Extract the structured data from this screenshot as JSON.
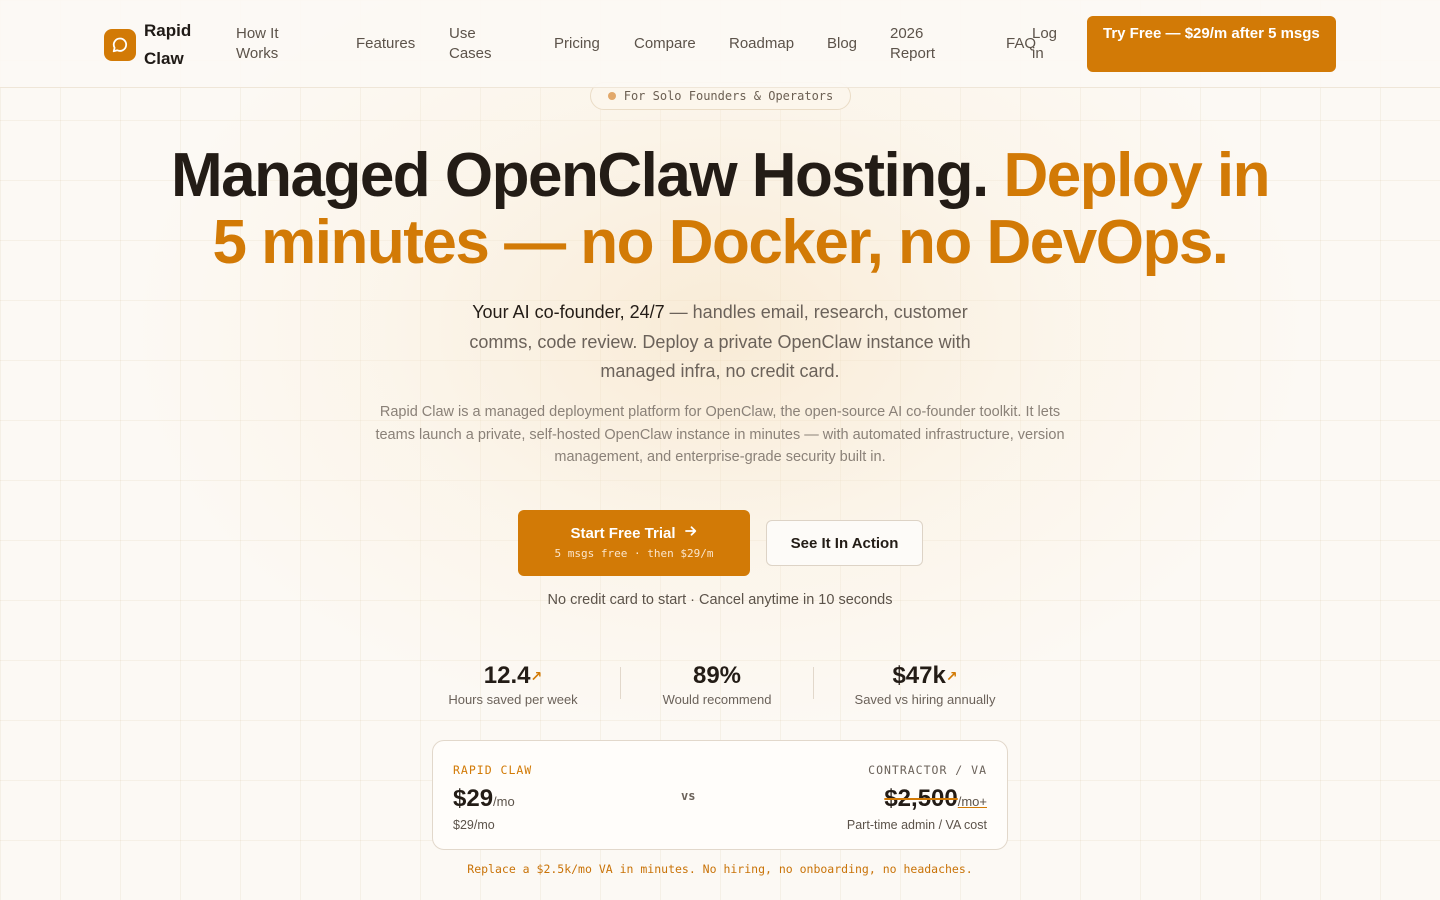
{
  "brand": {
    "name": "Rapid Claw",
    "accent": "#d27a06"
  },
  "nav": {
    "links": [
      "How It Works",
      "Features",
      "Use Cases",
      "Pricing",
      "Compare",
      "Roadmap",
      "Blog",
      "2026 Report",
      "FAQ"
    ],
    "login": "Log in",
    "cta": "Try Free — $29/m after 5 msgs"
  },
  "hero": {
    "badge": "For Solo Founders & Operators",
    "headline_dark": "Managed OpenClaw Hosting.",
    "headline_accent": "Deploy in 5 minutes — no Docker, no DevOps.",
    "subhead_strong": "Your AI co-founder, 24/7",
    "subhead_rest": " — handles email, research, customer comms, code review. Deploy a private OpenClaw instance with managed infra, no credit card.",
    "description": "Rapid Claw is a managed deployment platform for OpenClaw, the open-source AI co-founder toolkit. It lets teams launch a private, self-hosted OpenClaw instance in minutes — with automated infrastructure, version management, and enterprise-grade security built in.",
    "primary_cta": "Start Free Trial",
    "primary_cta_sub": "5 msgs free · then $29/m",
    "secondary_cta": "See It In Action",
    "fine_print": "No credit card to start · Cancel anytime in 10 seconds"
  },
  "stats": [
    {
      "value": "12.4",
      "arrow": "↗",
      "label": "Hours saved per week"
    },
    {
      "value": "89%",
      "arrow": "",
      "label": "Would recommend"
    },
    {
      "value": "$47k",
      "arrow": "↗",
      "label": "Saved vs hiring annually"
    }
  ],
  "compare": {
    "left_label": "RAPID CLAW",
    "left_price": "$29",
    "left_unit": "/mo",
    "left_note": "$29/mo",
    "vs": "vs",
    "right_label": "CONTRACTOR / VA",
    "right_price": "$2,500",
    "right_unit": "/mo+",
    "right_note": "Part-time admin / VA cost"
  },
  "tagline": "Replace a $2.5k/mo VA in minutes. No hiring, no onboarding, no headaches."
}
